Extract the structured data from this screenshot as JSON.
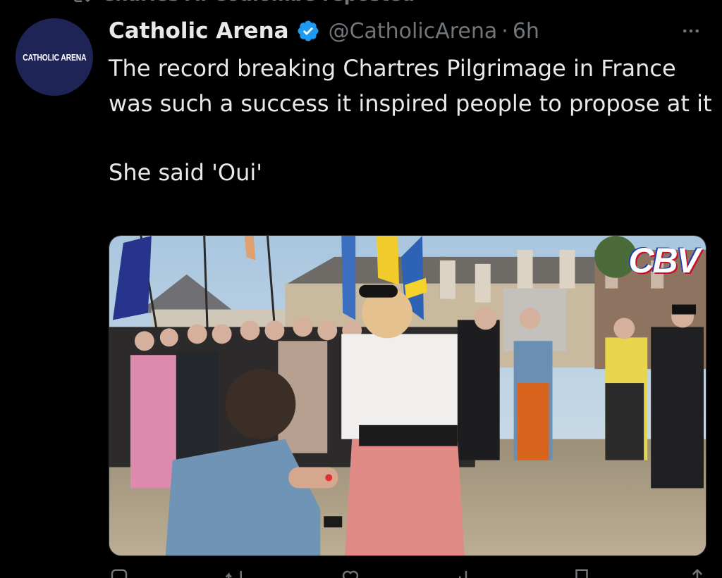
{
  "repost": {
    "label": "Charles A. Coulombe reposted",
    "icon": "repost-icon"
  },
  "author": {
    "avatar_text": "CATHOLIC ARENA",
    "display_name": "Catholic Arena",
    "verified": true,
    "handle": "@CatholicArena",
    "separator": "·",
    "time": "6h"
  },
  "tweet": {
    "text_line_1": "The record breaking Chartres Pilgrimage in France was such a success it inspired people to propose at it",
    "text_line_2": "She said 'Oui'"
  },
  "media": {
    "type": "video",
    "overlay_text": "CBV",
    "overlay_colors": [
      "#1d3fb3",
      "#ffffff",
      "#c8102e"
    ]
  },
  "actions": [
    {
      "name": "reply-icon"
    },
    {
      "name": "repost-icon"
    },
    {
      "name": "like-icon"
    },
    {
      "name": "views-icon"
    },
    {
      "name": "bookmark-icon"
    },
    {
      "name": "share-icon"
    }
  ],
  "colors": {
    "background": "#000000",
    "text_primary": "#e7e9ea",
    "text_secondary": "#71767b",
    "verified_blue": "#1d9bf0",
    "avatar_bg": "#1f2456"
  }
}
